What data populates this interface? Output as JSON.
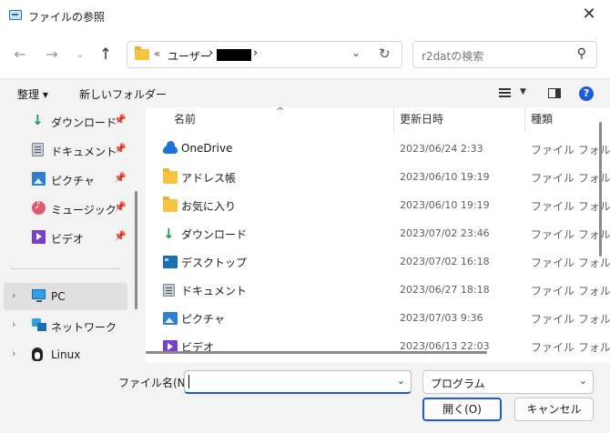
{
  "window": {
    "title": "ファイルの参照"
  },
  "address_bar": {
    "overflow_chevron": "«",
    "crumbs": [
      "ユーザー"
    ],
    "separator": "›"
  },
  "search": {
    "placeholder": "r2datの検索"
  },
  "toolbar": {
    "organize_label": "整理 ▾",
    "new_folder_label": "新しいフォルダー",
    "help_label": "?"
  },
  "sidebar": {
    "quick_access": [
      {
        "label": "ダウンロード",
        "icon": "download-icon"
      },
      {
        "label": "ドキュメント",
        "icon": "document-icon"
      },
      {
        "label": "ピクチャ",
        "icon": "picture-icon"
      },
      {
        "label": "ミュージック",
        "icon": "music-icon"
      },
      {
        "label": "ビデオ",
        "icon": "video-icon"
      }
    ],
    "tree": [
      {
        "label": "PC",
        "icon": "pc-icon",
        "selected": true
      },
      {
        "label": "ネットワーク",
        "icon": "network-icon",
        "selected": false
      },
      {
        "label": "Linux",
        "icon": "linux-icon",
        "selected": false
      }
    ]
  },
  "file_list": {
    "columns": [
      "名前",
      "更新日時",
      "種類"
    ],
    "rows": [
      {
        "name": "OneDrive",
        "date": "2023/06/24 2:33",
        "type": "ファイル フォルダー",
        "icon": "onedrive-icon"
      },
      {
        "name": "アドレス帳",
        "date": "2023/06/10 19:19",
        "type": "ファイル フォルダー",
        "icon": "folder-icon"
      },
      {
        "name": "お気に入り",
        "date": "2023/06/10 19:19",
        "type": "ファイル フォルダー",
        "icon": "folder-icon"
      },
      {
        "name": "ダウンロード",
        "date": "2023/07/02 23:46",
        "type": "ファイル フォルダー",
        "icon": "download-icon"
      },
      {
        "name": "デスクトップ",
        "date": "2023/07/02 16:18",
        "type": "ファイル フォルダー",
        "icon": "desktop-icon"
      },
      {
        "name": "ドキュメント",
        "date": "2023/06/27 18:18",
        "type": "ファイル フォルダー",
        "icon": "document-icon"
      },
      {
        "name": "ピクチャ",
        "date": "2023/07/03 9:36",
        "type": "ファイル フォルダー",
        "icon": "picture-icon"
      },
      {
        "name": "ビデオ",
        "date": "2023/06/13 22:03",
        "type": "ファイル フォルダー",
        "icon": "video-icon"
      }
    ]
  },
  "footer": {
    "filename_label": "ファイル名(N):",
    "filename_value": "",
    "filter_value": "プログラム",
    "open_label": "開く(O)",
    "cancel_label": "キャンセル"
  },
  "colors": {
    "accent": "#1e5bd6",
    "folder": "#f6c343",
    "selected_bg": "#e0e0e0"
  }
}
